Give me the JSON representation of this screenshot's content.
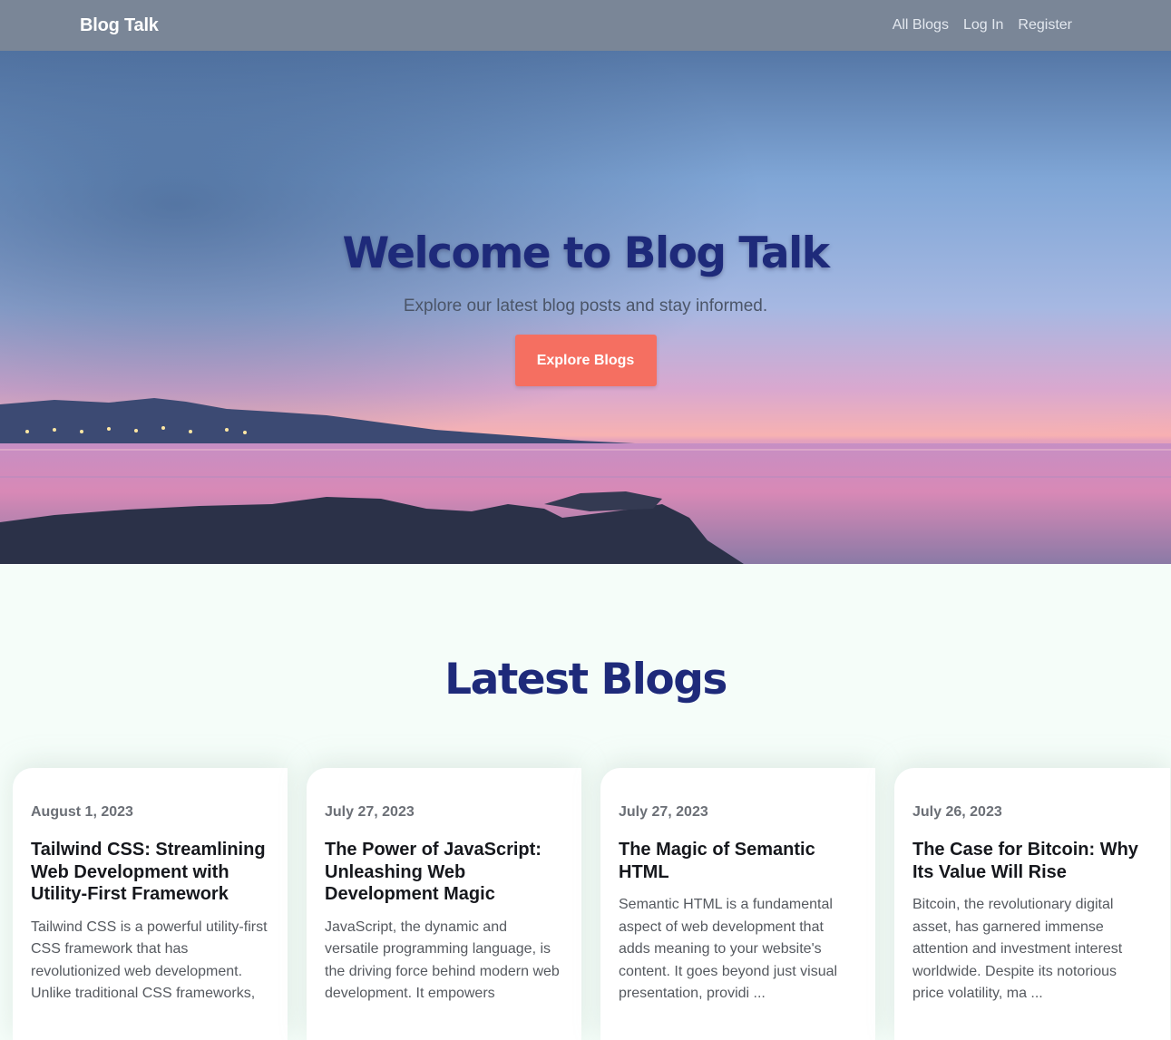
{
  "navbar": {
    "brand": "Blog Talk",
    "links": [
      "All Blogs",
      "Log In",
      "Register"
    ]
  },
  "hero": {
    "title": "Welcome to Blog Talk",
    "subtitle": "Explore our latest blog posts and stay informed.",
    "cta_label": "Explore Blogs",
    "background_image": "sunset-sea-photo"
  },
  "latest": {
    "title": "Latest Blogs",
    "posts": [
      {
        "date": "August 1, 2023",
        "title": "Tailwind CSS: Streamlining Web Development with Utility-First Framework",
        "excerpt": "Tailwind CSS is a powerful utility-first CSS framework that has revolutionized web development. Unlike traditional CSS frameworks,"
      },
      {
        "date": "July 27, 2023",
        "title": "The Power of JavaScript: Unleashing Web Development Magic",
        "excerpt": "JavaScript, the dynamic and versatile programming language, is the driving force behind modern web development. It empowers"
      },
      {
        "date": "July 27, 2023",
        "title": "The Magic of Semantic HTML",
        "excerpt": "Semantic HTML is a fundamental aspect of web development that adds meaning to your website's content. It goes beyond just visual presentation, providi ..."
      },
      {
        "date": "July 26, 2023",
        "title": "The Case for Bitcoin: Why Its Value Will Rise",
        "excerpt": "Bitcoin, the revolutionary digital asset, has garnered immense attention and investment interest worldwide. Despite its notorious price volatility, ma ..."
      }
    ]
  },
  "colors": {
    "navbar_bg": "#7a8697",
    "accent_button": "#f56f61",
    "heading_navy": "#1e2a7a",
    "page_bg": "#f5fdf9"
  }
}
